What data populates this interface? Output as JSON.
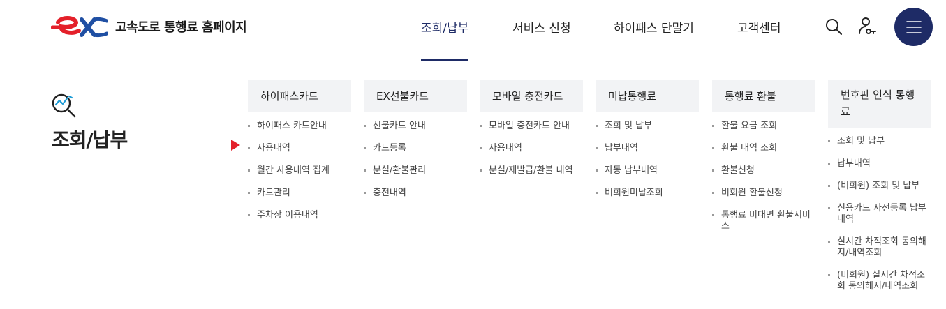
{
  "header": {
    "logo_text": "고속도로 통행료 홈페이지",
    "nav": [
      {
        "label": "조회/납부",
        "active": true
      },
      {
        "label": "서비스 신청",
        "active": false
      },
      {
        "label": "하이패스 단말기",
        "active": false
      },
      {
        "label": "고객센터",
        "active": false
      }
    ],
    "icons": [
      "search-icon",
      "user-key-icon",
      "hamburger-menu-icon"
    ]
  },
  "left_panel": {
    "icon": "search-chart-icon",
    "title": "조회/납부"
  },
  "columns": [
    {
      "title": "하이패스카드",
      "items": [
        "하이패스 카드안내",
        "사용내역",
        "월간 사용내역 집계",
        "카드관리",
        "주차장 이용내역"
      ]
    },
    {
      "title": "EX선불카드",
      "items": [
        "선불카드 안내",
        "카드등록",
        "분실/환불관리",
        "충전내역"
      ]
    },
    {
      "title": "모바일 충전카드",
      "items": [
        "모바일 충전카드 안내",
        "사용내역",
        "분실/재발급/환불 내역"
      ]
    },
    {
      "title": "미납통행료",
      "items": [
        "조회 및 납부",
        "납부내역",
        "자동 납부내역",
        "비회원미납조회"
      ]
    },
    {
      "title": "통행료 환불",
      "items": [
        "환불 요금 조회",
        "환불 내역 조회",
        "환불신청",
        "비회원 환불신청",
        "통행료 비대면 환불서비스"
      ]
    },
    {
      "title": "번호판 인식 통행료",
      "items": [
        "조회 및 납부",
        "납부내역",
        "(비회원) 조회 및 납부",
        "신용카드 사전등록 납부내역",
        "실시간 차적조회 동의해지/내역조회",
        "(비회원) 실시간 차적조회 동의해지/내역조회"
      ]
    }
  ],
  "colors": {
    "brand_navy": "#1e2b66",
    "brand_red": "#e4202a",
    "brand_blue": "#1f4fa3"
  }
}
